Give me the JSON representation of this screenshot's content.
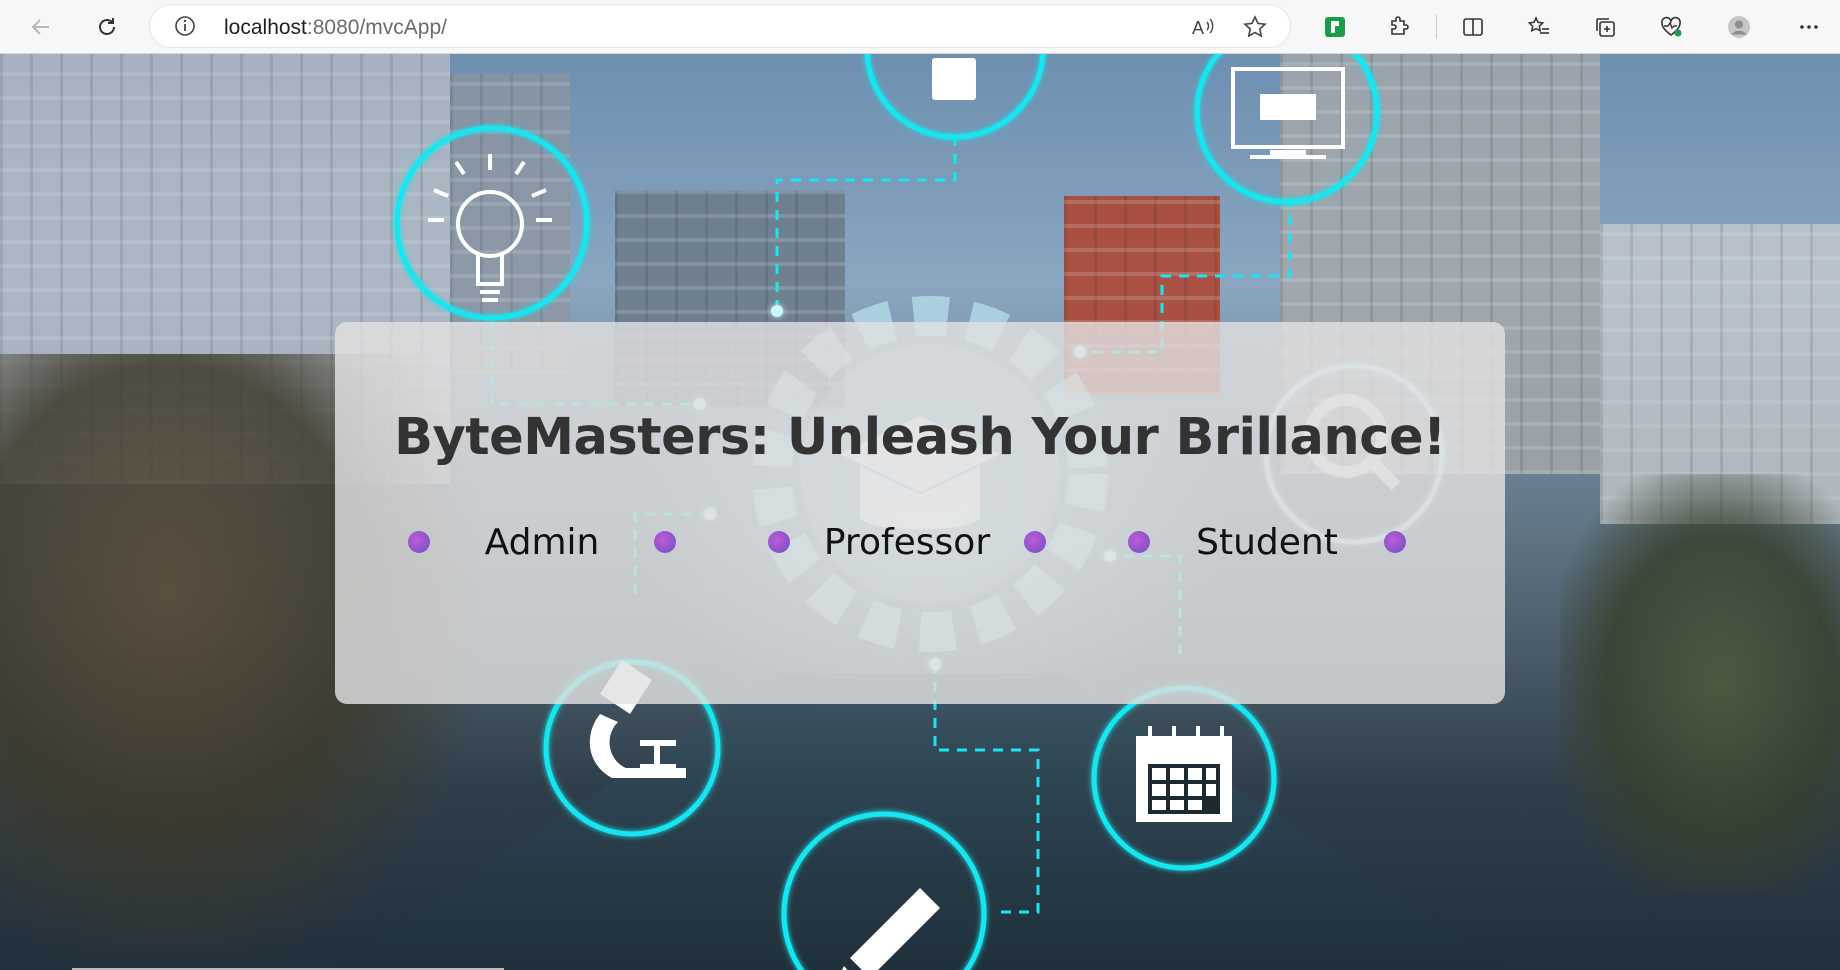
{
  "browser": {
    "url_host": "localhost",
    "url_path": ":8080/mvcApp/",
    "icons": {
      "back": "back-arrow-icon",
      "reload": "reload-icon",
      "site_info": "info-icon",
      "read_aloud": "read-aloud-icon",
      "favorite": "star-icon",
      "extension_app": "green-extension-icon",
      "extensions": "puzzle-icon",
      "split_screen": "split-screen-icon",
      "favorites": "favorites-list-icon",
      "collections": "collections-icon",
      "browser_essentials": "heart-pulse-icon",
      "profile": "profile-avatar-icon",
      "menu": "more-dots-icon"
    }
  },
  "hero": {
    "title": "ByteMasters: Unleash Your Brillance!",
    "roles": [
      {
        "label": "Admin"
      },
      {
        "label": "Professor"
      },
      {
        "label": "Student"
      }
    ]
  },
  "colors": {
    "accent_cyan": "#19e6f0",
    "role_dot": "#a259d9",
    "title_text": "#333333"
  }
}
